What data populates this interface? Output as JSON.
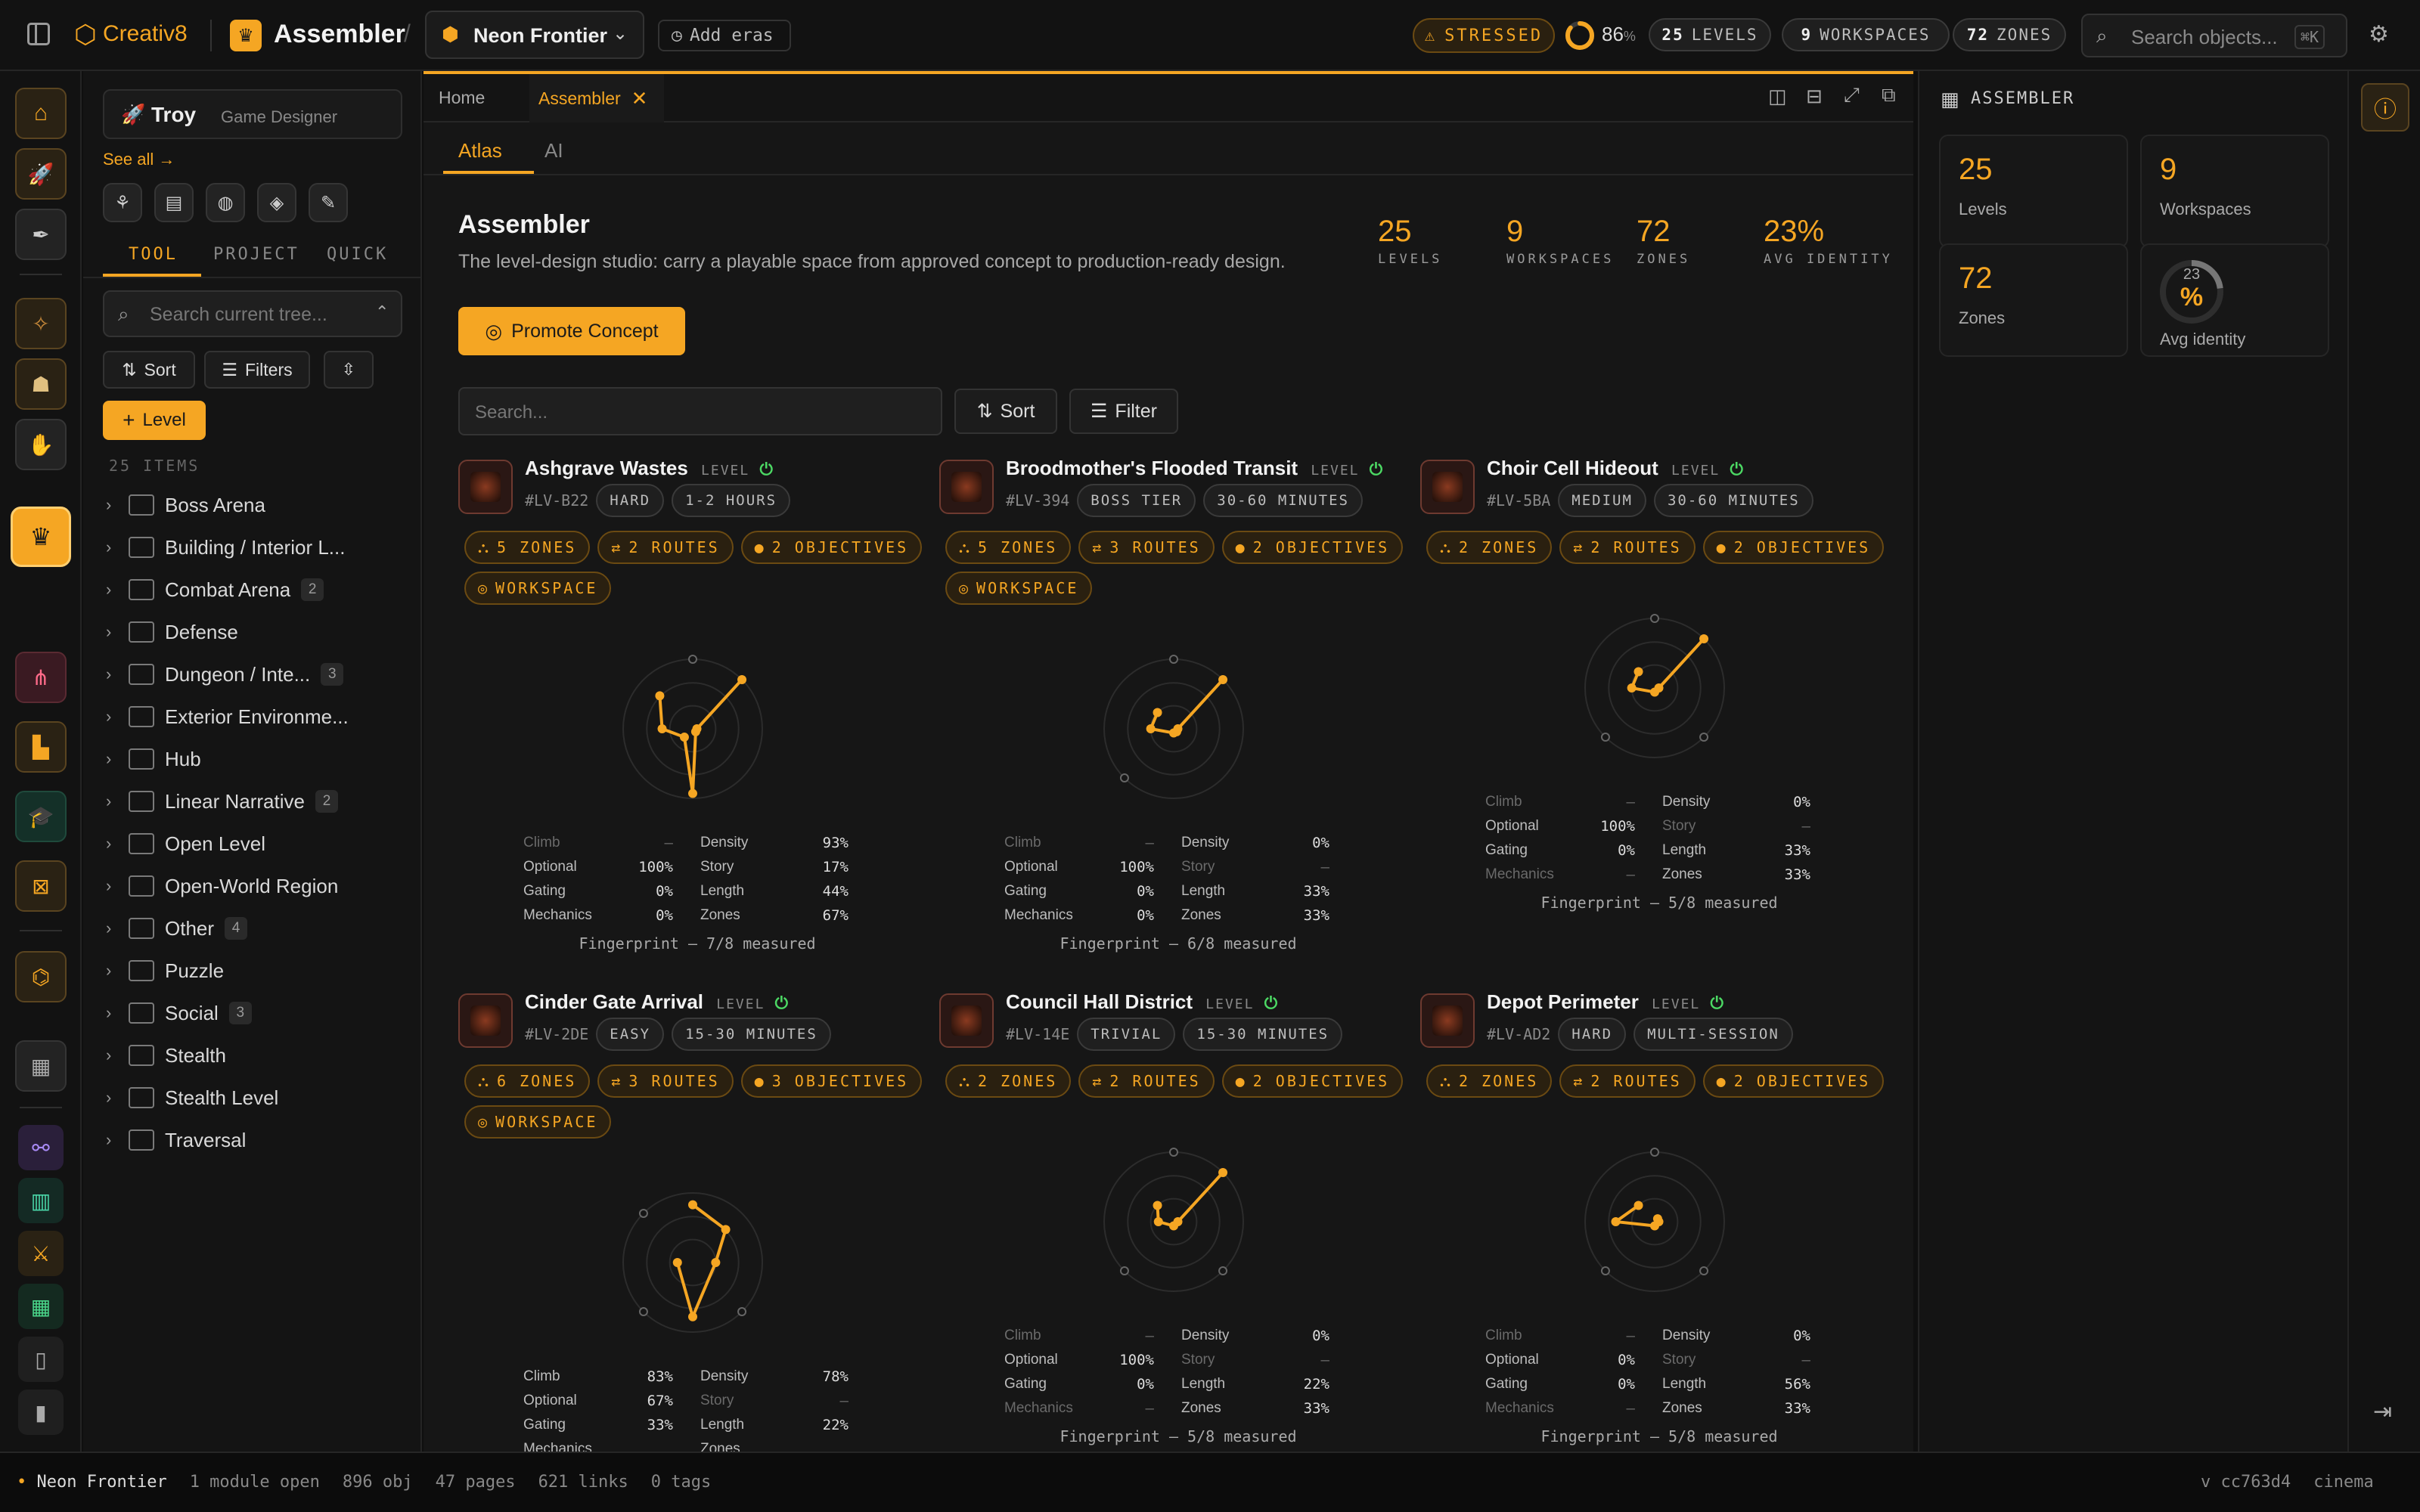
{
  "topbar": {
    "brand": "Creativ8",
    "module": "Assembler",
    "project": "Neon Frontier",
    "add_eras": "Add eras",
    "stress_label": "STRESSED",
    "stress_percent": "86",
    "percent_sign": "%",
    "levels_count": "25",
    "levels_label": "LEVELS",
    "workspaces_count": "9",
    "workspaces_label": "WORKSPACES",
    "zones_count": "72",
    "zones_label": "ZONES",
    "search_placeholder": "Search objects...",
    "search_shortcut": "⌘K"
  },
  "sidebar": {
    "user_name": "Troy",
    "user_role": "Game Designer",
    "see_all": "See all →",
    "tabs": [
      "TOOL",
      "PROJECT",
      "QUICK"
    ],
    "search_placeholder": "Search current tree...",
    "sort": "Sort",
    "filters": "Filters",
    "add_level": "Level",
    "items_count": "25 ITEMS",
    "tree": [
      {
        "label": "Boss Arena",
        "count": ""
      },
      {
        "label": "Building / Interior L...",
        "count": ""
      },
      {
        "label": "Combat Arena",
        "count": "2"
      },
      {
        "label": "Defense",
        "count": ""
      },
      {
        "label": "Dungeon / Inte...",
        "count": "3"
      },
      {
        "label": "Exterior Environme...",
        "count": ""
      },
      {
        "label": "Hub",
        "count": ""
      },
      {
        "label": "Linear Narrative",
        "count": "2"
      },
      {
        "label": "Open Level",
        "count": ""
      },
      {
        "label": "Open-World Region",
        "count": ""
      },
      {
        "label": "Other",
        "count": "4"
      },
      {
        "label": "Puzzle",
        "count": ""
      },
      {
        "label": "Social",
        "count": "3"
      },
      {
        "label": "Stealth",
        "count": ""
      },
      {
        "label": "Stealth Level",
        "count": ""
      },
      {
        "label": "Traversal",
        "count": ""
      }
    ]
  },
  "main": {
    "tabs": [
      {
        "label": "Home"
      },
      {
        "label": "Assembler"
      }
    ],
    "subtabs": [
      "Atlas",
      "AI"
    ],
    "title": "Assembler",
    "description": "The level-design studio: carry a playable space from approved concept to production-ready design.",
    "kpis": [
      {
        "value": "25",
        "label": "LEVELS"
      },
      {
        "value": "9",
        "label": "WORKSPACES"
      },
      {
        "value": "72",
        "label": "ZONES"
      },
      {
        "value": "23%",
        "label": "AVG IDENTITY"
      }
    ],
    "promote": "Promote Concept",
    "search_placeholder": "Search...",
    "sort": "Sort",
    "filter": "Filter",
    "level_tag": "LEVEL",
    "workspace_tag": "WORKSPACE",
    "axis_labels": [
      "Climb",
      "Optional",
      "Gating",
      "Mechanics",
      "Density",
      "Story",
      "Length",
      "Zones"
    ],
    "cards": [
      {
        "title": "Ashgrave Wastes",
        "id": "#LV-B22",
        "difficulty": "HARD",
        "duration": "1-2 HOURS",
        "zones": "5 ZONES",
        "routes": "2 ROUTES",
        "objectives": "2 OBJECTIVES",
        "workspace": true,
        "stats": [
          "–",
          "100%",
          "0%",
          "0%",
          "93%",
          "17%",
          "44%",
          "67%"
        ],
        "radar": [
          null,
          1.0,
          0,
          0,
          0.93,
          0.17,
          0.44,
          0.67
        ],
        "footer": "Fingerprint — 7/8 measured"
      },
      {
        "title": "Broodmother's Flooded Transit",
        "id": "#LV-394",
        "difficulty": "BOSS TIER",
        "duration": "30-60 MINUTES",
        "zones": "5 ZONES",
        "routes": "3 ROUTES",
        "objectives": "2 OBJECTIVES",
        "workspace": true,
        "stats": [
          "–",
          "100%",
          "0%",
          "0%",
          "0%",
          "–",
          "33%",
          "33%"
        ],
        "radar": [
          null,
          1.0,
          0,
          0,
          0,
          null,
          0.33,
          0.33
        ],
        "footer": "Fingerprint — 6/8 measured"
      },
      {
        "title": "Choir Cell Hideout",
        "id": "#LV-5BA",
        "difficulty": "MEDIUM",
        "duration": "30-60 MINUTES",
        "zones": "2 ZONES",
        "routes": "2 ROUTES",
        "objectives": "2 OBJECTIVES",
        "workspace": false,
        "stats": [
          "–",
          "100%",
          "0%",
          "–",
          "0%",
          "–",
          "33%",
          "33%"
        ],
        "radar": [
          null,
          1.0,
          0,
          null,
          0,
          null,
          0.33,
          0.33
        ],
        "footer": "Fingerprint — 5/8 measured"
      },
      {
        "title": "Cinder Gate Arrival",
        "id": "#LV-2DE",
        "difficulty": "EASY",
        "duration": "15-30 MINUTES",
        "zones": "6 ZONES",
        "routes": "3 ROUTES",
        "objectives": "3 OBJECTIVES",
        "workspace": true,
        "stats": [
          "83%",
          "67%",
          "33%",
          "",
          "78%",
          "–",
          "22%",
          ""
        ],
        "radar": [
          0.83,
          0.67,
          0.33,
          null,
          0.78,
          null,
          0.22,
          null
        ],
        "footer": ""
      },
      {
        "title": "Council Hall District",
        "id": "#LV-14E",
        "difficulty": "TRIVIAL",
        "duration": "15-30 MINUTES",
        "zones": "2 ZONES",
        "routes": "2 ROUTES",
        "objectives": "2 OBJECTIVES",
        "workspace": false,
        "stats": [
          "–",
          "100%",
          "0%",
          "–",
          "0%",
          "–",
          "22%",
          "33%"
        ],
        "radar": [
          null,
          1.0,
          0,
          null,
          0,
          null,
          0.22,
          0.33
        ],
        "footer": "Fingerprint — 5/8 measured"
      },
      {
        "title": "Depot Perimeter",
        "id": "#LV-AD2",
        "difficulty": "HARD",
        "duration": "MULTI-SESSION",
        "zones": "2 ZONES",
        "routes": "2 ROUTES",
        "objectives": "2 OBJECTIVES",
        "workspace": false,
        "stats": [
          "–",
          "0%",
          "0%",
          "–",
          "0%",
          "–",
          "56%",
          "33%"
        ],
        "radar": [
          null,
          0,
          0,
          null,
          0,
          null,
          0.56,
          0.33
        ],
        "footer": "Fingerprint — 5/8 measured"
      }
    ]
  },
  "rpanel": {
    "title": "ASSEMBLER",
    "levels": "25",
    "levels_label": "Levels",
    "workspaces": "9",
    "workspaces_label": "Workspaces",
    "zones": "72",
    "zones_label": "Zones",
    "avg_value": "23",
    "avg_unit": "%",
    "avg_label": "Avg identity",
    "avg_fraction": 0.23
  },
  "status": {
    "project": "Neon Frontier",
    "modules": "1 module open",
    "objects": "896 obj",
    "pages": "47 pages",
    "links": "621 links",
    "tags": "0 tags",
    "version": "v cc763d4",
    "theme": "cinema"
  },
  "colors": {
    "accent": "#f5a623",
    "ok": "#4cd964",
    "bg": "#0f0f0f"
  }
}
